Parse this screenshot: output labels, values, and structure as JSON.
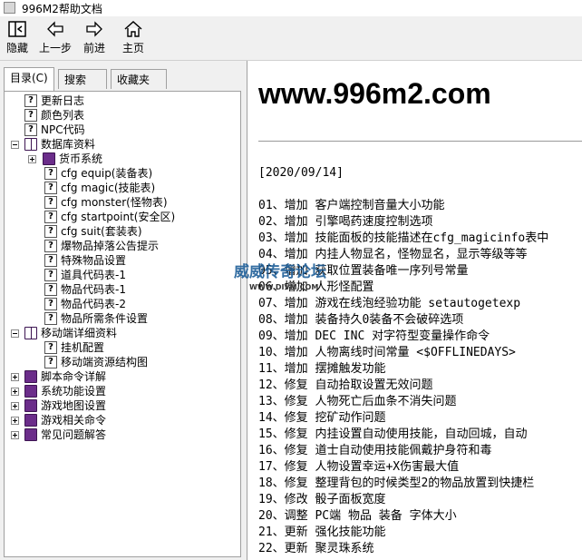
{
  "window": {
    "title": "996M2帮助文档"
  },
  "toolbar": {
    "hide_label": "隐藏",
    "back_label": "上一步",
    "forward_label": "前进",
    "home_label": "主页"
  },
  "tabs": [
    {
      "label": "目录(C)"
    },
    {
      "label": "搜索(S)"
    },
    {
      "label": "收藏夹(I)"
    }
  ],
  "tree": [
    {
      "label": "更新日志",
      "icon": "question-page-icon"
    },
    {
      "label": "颜色列表",
      "icon": "question-page-icon"
    },
    {
      "label": "NPC代码",
      "icon": "question-page-icon"
    },
    {
      "label": "数据库资料",
      "icon": "book-open-icon"
    },
    {
      "label": "货币系统",
      "icon": "book-closed-icon"
    },
    {
      "label": "cfg equip(装备表)",
      "icon": "question-page-icon"
    },
    {
      "label": "cfg magic(技能表)",
      "icon": "question-page-icon"
    },
    {
      "label": "cfg monster(怪物表)",
      "icon": "question-page-icon"
    },
    {
      "label": "cfg startpoint(安全区)",
      "icon": "question-page-icon"
    },
    {
      "label": "cfg suit(套装表)",
      "icon": "question-page-icon"
    },
    {
      "label": "爆物品掉落公告提示",
      "icon": "question-page-icon"
    },
    {
      "label": "特殊物品设置",
      "icon": "question-page-icon"
    },
    {
      "label": "道具代码表-1",
      "icon": "question-page-icon"
    },
    {
      "label": "物品代码表-1",
      "icon": "question-page-icon"
    },
    {
      "label": "物品代码表-2",
      "icon": "question-page-icon"
    },
    {
      "label": "物品所需条件设置",
      "icon": "question-page-icon"
    },
    {
      "label": "移动端详细资料",
      "icon": "book-open-icon"
    },
    {
      "label": "挂机配置",
      "icon": "question-page-icon"
    },
    {
      "label": "移动端资源结构图",
      "icon": "question-page-icon"
    },
    {
      "label": "脚本命令详解",
      "icon": "book-closed-icon"
    },
    {
      "label": "系统功能设置",
      "icon": "book-closed-icon"
    },
    {
      "label": "游戏地图设置",
      "icon": "book-closed-icon"
    },
    {
      "label": "游戏相关命令",
      "icon": "book-closed-icon"
    },
    {
      "label": "常见问题解答",
      "icon": "book-closed-icon"
    }
  ],
  "content": {
    "heading": "www.996m2.com",
    "date": "[2020/09/14]",
    "lines": [
      "01、增加 客户端控制音量大小功能",
      "02、增加 引擎喝药速度控制选项",
      "03、增加 技能面板的技能描述在cfg_magicinfo表中",
      "04、增加 内挂人物显名，怪物显名，显示等级等等",
      "05、增加 获取位置装备唯一序列号常量",
      "06、增加 人形怪配置",
      "07、增加 游戏在线泡经验功能 setautogetexp",
      "08、增加 装备持久0装备不会破碎选项",
      "09、增加 DEC INC 对字符型变量操作命令",
      "10、增加 人物离线时间常量 <$OFFLINEDAYS>",
      "11、增加 摆摊触发功能",
      "12、修复 自动拾取设置无效问题",
      "13、修复 人物死亡后血条不消失问题",
      "14、修复 挖矿动作问题",
      "15、修复 内挂设置自动使用技能，自动回城，自动",
      "16、修复 道士自动使用技能佩戴护身符和毒",
      "17、修复 人物设置幸运+X伤害最大值",
      "18、修复 整理背包的时候类型2的物品放置到快捷栏",
      "19、修改 骰子面板宽度",
      "20、调整 PC端 物品 装备 字体大小",
      "21、更新 强化技能功能",
      "22、更新 聚灵珠系统"
    ]
  },
  "watermark": {
    "main": "威威传奇论坛",
    "sub": "WWW.DIVM.COM"
  }
}
